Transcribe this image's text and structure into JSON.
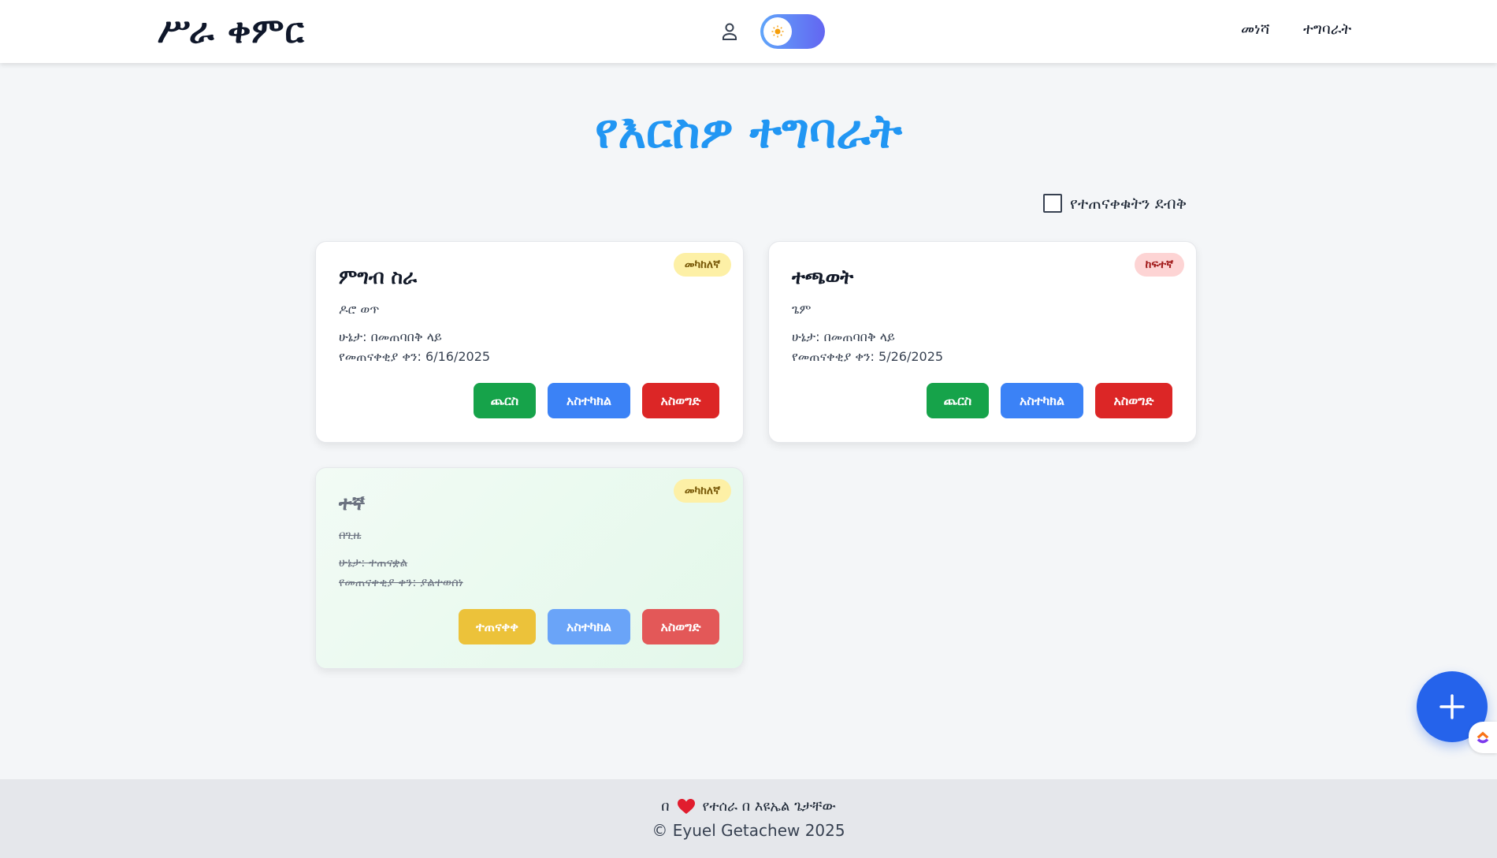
{
  "header": {
    "brand": "ሥራ ቀምር",
    "nav": [
      {
        "label": "መነሻ"
      },
      {
        "label": "ተግባራት"
      }
    ]
  },
  "main": {
    "title": "የእርስዎ ተግባራት",
    "filter_label": "የተጠናቀቁትን ደብቅ",
    "filter_checked": false
  },
  "tasks": [
    {
      "title": "ምግብ ስራ",
      "description": "ዶሮ ወጥ",
      "status": "ሁኔታ: በመጠባበቅ ላይ",
      "due": "የመጠናቀቂያ ቀን: 6/16/2025",
      "priority": "መካከለኛ",
      "priority_color": "#fdf0a6",
      "completed": false,
      "actions": {
        "toggle": "ጨርስ",
        "edit": "አስተካክል",
        "delete": "አስወግድ"
      }
    },
    {
      "title": "ተጫወት",
      "description": "ጌም",
      "status": "ሁኔታ: በመጠባበቅ ላይ",
      "due": "የመጠናቀቂያ ቀን: 5/26/2025",
      "priority": "ከፍተኛ",
      "priority_color": "#fdd4d4",
      "completed": false,
      "actions": {
        "toggle": "ጨርስ",
        "edit": "አስተካክል",
        "delete": "አስወግድ"
      }
    },
    {
      "title": "ተኛ",
      "description": "በጊዜ",
      "status": "ሁኔታ: ተጠናቋል",
      "due": "የመጠናቀቂያ ቀን: ያልተወሰነ",
      "priority": "መካከለኛ",
      "priority_color": "#fdf0a6",
      "completed": true,
      "actions": {
        "toggle": "ተጠናቀቀ",
        "edit": "አስተካክል",
        "delete": "አስወግድ"
      }
    }
  ],
  "footer": {
    "line1_prefix": "በ",
    "line1_suffix": "የተሰራ በ እዩኤል ጌታቸው",
    "copyright": "© Eyuel Getachew 2025"
  },
  "colors": {
    "accent": "#2196f3",
    "primary_button": "#3b82f6",
    "success": "#16a34a",
    "danger": "#dc2626",
    "warning": "#eab308",
    "fab": "#2563eb"
  },
  "icons": {
    "user": "user-icon",
    "theme": "sun-icon",
    "fab": "plus-icon",
    "heart": "heart-icon",
    "clickup": "clickup-icon"
  }
}
